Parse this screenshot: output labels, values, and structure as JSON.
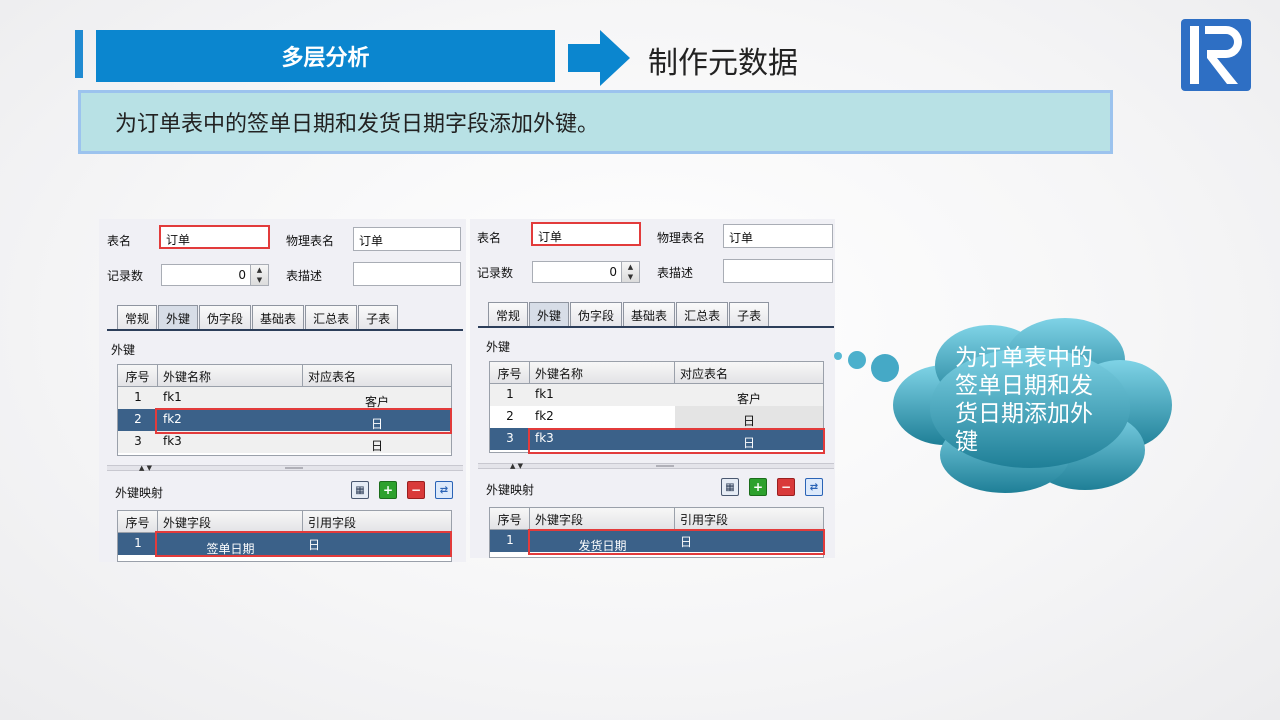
{
  "header": {
    "title": "多层分析",
    "subtitle": "制作元数据",
    "description": "为订单表中的签单日期和发货日期字段添加外键。"
  },
  "callout": {
    "text": "为订单表中的签单日期和发货日期添加外键"
  },
  "colors": {
    "accent": "#0b86cf",
    "selected_row": "#3b6189",
    "highlight": "#e23b3b",
    "desc_bg": "#b8e1e5",
    "cloud": "#3aa9c4"
  },
  "panels": [
    {
      "table_name_label": "表名",
      "table_name_value": "订单",
      "physical_label": "物理表名",
      "physical_value": "订单",
      "records_label": "记录数",
      "records_value": "0",
      "desc_label": "表描述",
      "desc_value": "",
      "tabs": [
        "常规",
        "外键",
        "伪字段",
        "基础表",
        "汇总表",
        "子表"
      ],
      "active_tab": "外键",
      "fk_section": "外键",
      "fk_headers": [
        "序号",
        "外键名称",
        "对应表名"
      ],
      "fk_rows": [
        {
          "no": "1",
          "name": "fk1",
          "ref": "客户"
        },
        {
          "no": "2",
          "name": "fk2",
          "ref": "日"
        },
        {
          "no": "3",
          "name": "fk3",
          "ref": "日"
        }
      ],
      "map_section": "外键映射",
      "map_headers": [
        "序号",
        "外键字段",
        "引用字段"
      ],
      "map_rows": [
        {
          "no": "1",
          "field": "签单日期",
          "ref": "日"
        }
      ]
    },
    {
      "table_name_label": "表名",
      "table_name_value": "订单",
      "physical_label": "物理表名",
      "physical_value": "订单",
      "records_label": "记录数",
      "records_value": "0",
      "desc_label": "表描述",
      "desc_value": "",
      "tabs": [
        "常规",
        "外键",
        "伪字段",
        "基础表",
        "汇总表",
        "子表"
      ],
      "active_tab": "外键",
      "fk_section": "外键",
      "fk_headers": [
        "序号",
        "外键名称",
        "对应表名"
      ],
      "fk_rows": [
        {
          "no": "1",
          "name": "fk1",
          "ref": "客户"
        },
        {
          "no": "2",
          "name": "fk2",
          "ref": "日"
        },
        {
          "no": "3",
          "name": "fk3",
          "ref": "日"
        }
      ],
      "map_section": "外键映射",
      "map_headers": [
        "序号",
        "外键字段",
        "引用字段"
      ],
      "map_rows": [
        {
          "no": "1",
          "field": "发货日期",
          "ref": "日"
        }
      ]
    }
  ]
}
